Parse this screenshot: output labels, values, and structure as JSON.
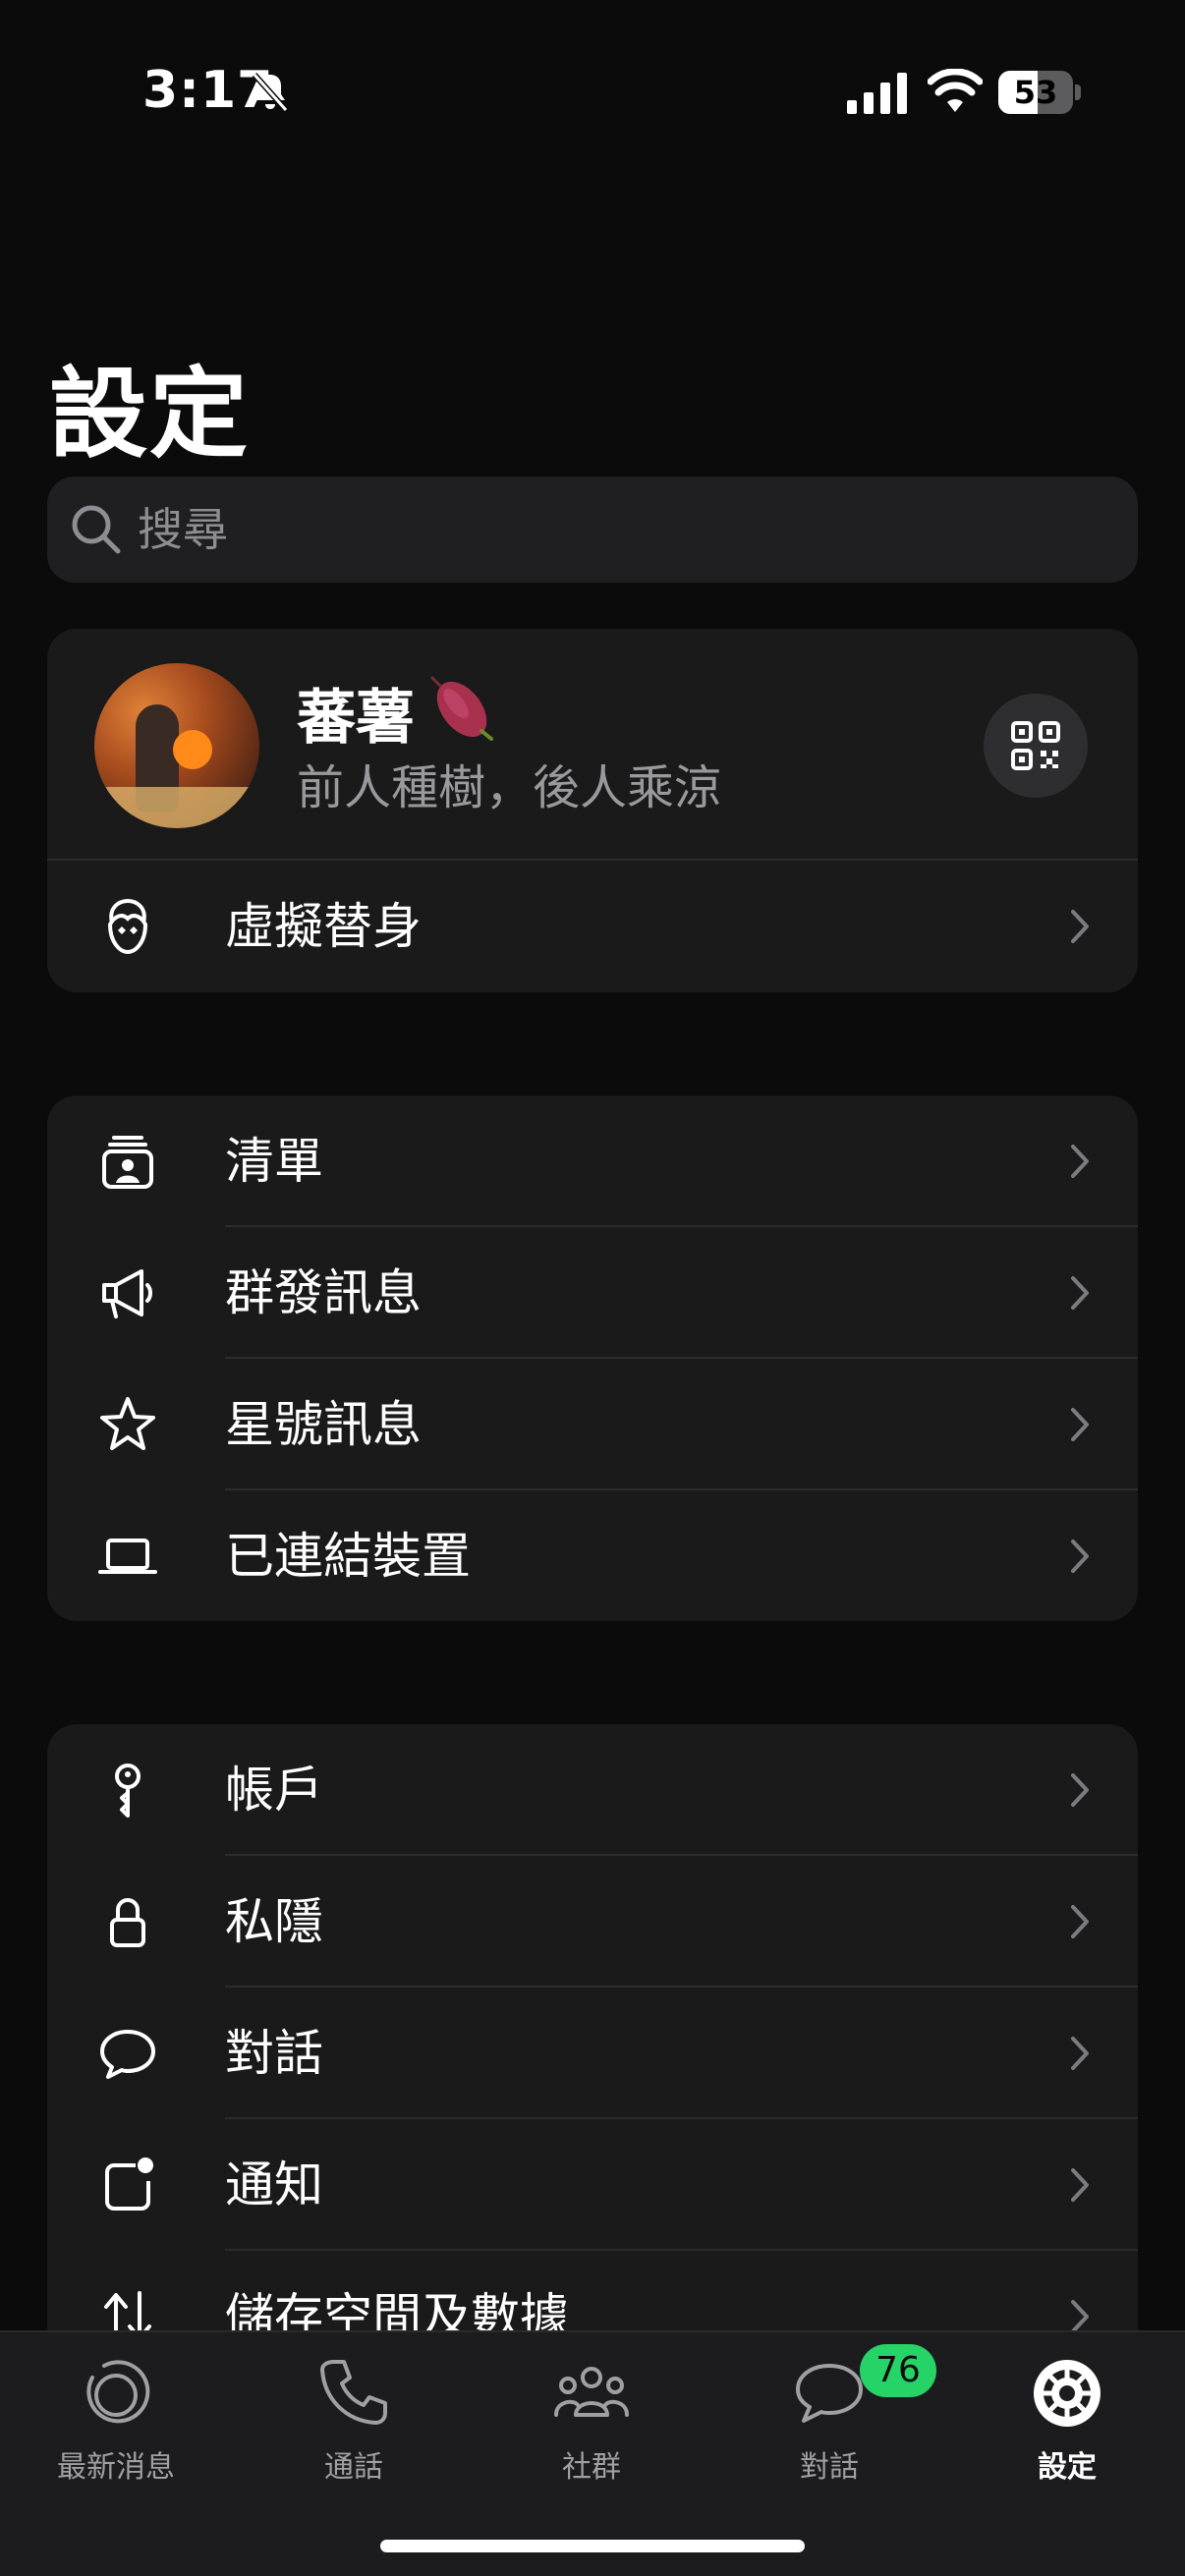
{
  "status_bar": {
    "time": "3:17",
    "battery": "53",
    "battery_level": 0.53
  },
  "title": "設定",
  "search": {
    "placeholder": "搜尋"
  },
  "profile": {
    "name": "蕃薯",
    "status": "前人種樹，後人乘涼",
    "avatar_row_label": "虛擬替身"
  },
  "lists_section": [
    {
      "label": "清單",
      "icon": "contact-card-icon"
    },
    {
      "label": "群發訊息",
      "icon": "megaphone-icon"
    },
    {
      "label": "星號訊息",
      "icon": "star-icon"
    },
    {
      "label": "已連結裝置",
      "icon": "laptop-icon"
    }
  ],
  "settings_section": [
    {
      "label": "帳戶",
      "icon": "key-icon"
    },
    {
      "label": "私隱",
      "icon": "lock-icon"
    },
    {
      "label": "對話",
      "icon": "chat-bubble-icon"
    },
    {
      "label": "通知",
      "icon": "notification-icon"
    },
    {
      "label": "儲存空間及數據",
      "icon": "data-transfer-icon"
    }
  ],
  "tabs": [
    {
      "label": "最新消息",
      "icon": "updates-icon"
    },
    {
      "label": "通話",
      "icon": "phone-icon"
    },
    {
      "label": "社群",
      "icon": "communities-icon"
    },
    {
      "label": "對話",
      "icon": "chats-icon",
      "badge": "76"
    },
    {
      "label": "設定",
      "icon": "settings-gear-icon",
      "active": true
    }
  ],
  "colors": {
    "accent": "#25d366",
    "background": "#0b0b0b",
    "card": "#1a1a1a"
  }
}
